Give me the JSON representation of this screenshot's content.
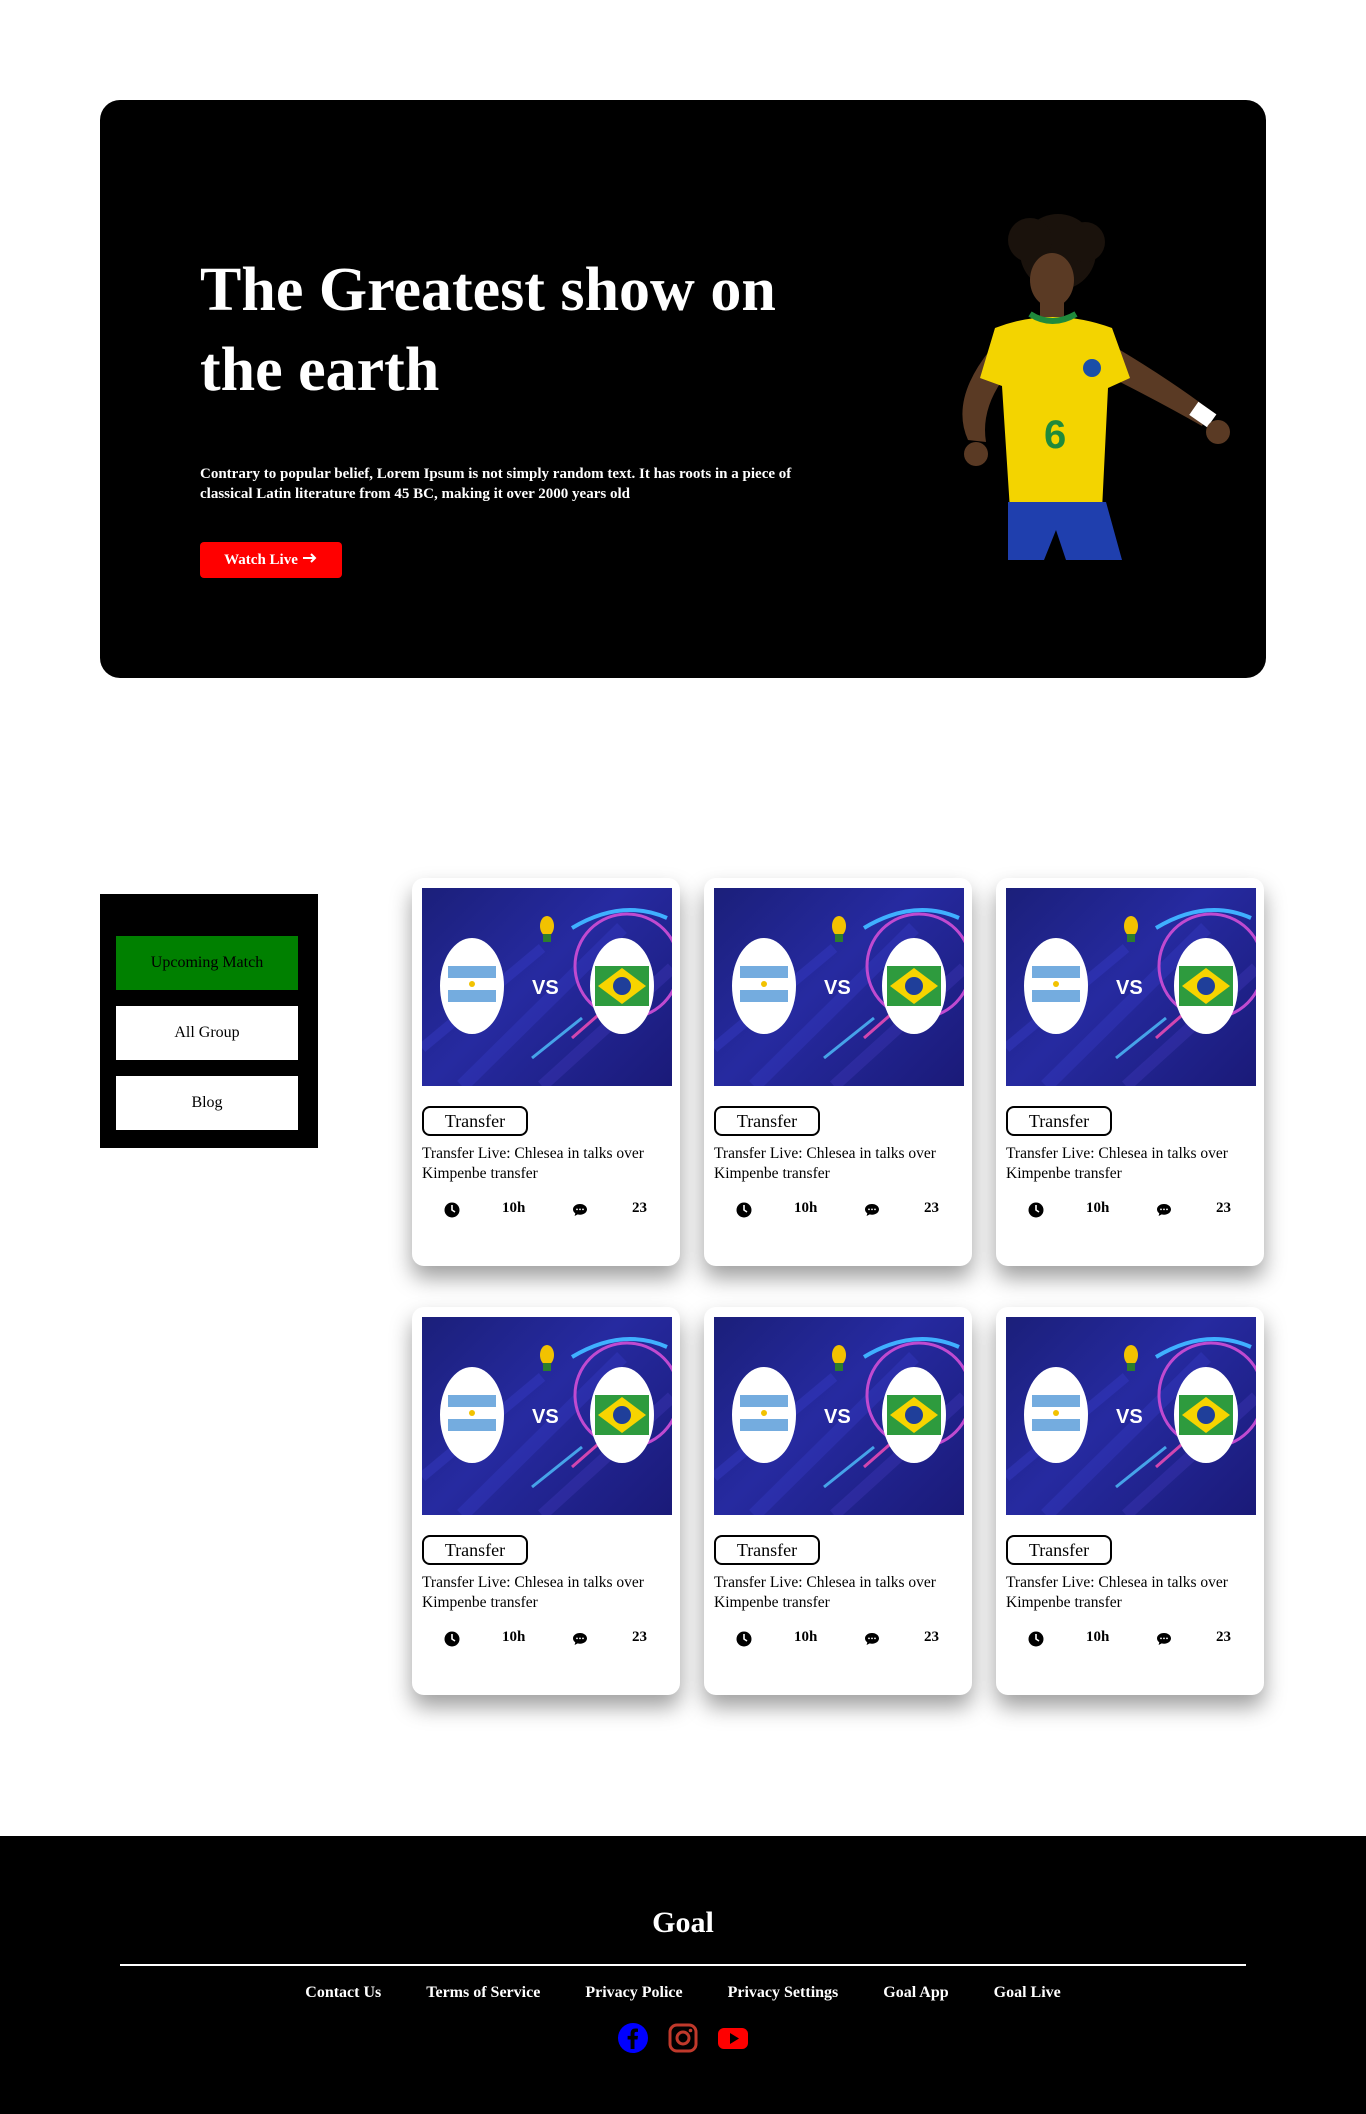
{
  "hero": {
    "title": "The Greatest show on the earth",
    "text": "Contrary to popular belief, Lorem Ipsum is not simply random text. It has roots in a piece of classical Latin literature from 45 BC, making it over 2000 years old",
    "button_label": "Watch Live",
    "button_icon": "arrow-right-icon",
    "accent_color": "#ff0000",
    "player_number": "6"
  },
  "sidebar": {
    "items": [
      {
        "label": "Upcoming Match",
        "active": true,
        "color": "#008000"
      },
      {
        "label": "All Group",
        "active": false
      },
      {
        "label": "Blog",
        "active": false
      }
    ]
  },
  "cards": [
    {
      "tag": "Transfer",
      "title": "Transfer Live: Chlesea in talks over Kimpenbe transfer",
      "versus": "VS",
      "time": "10h",
      "comments": "23"
    },
    {
      "tag": "Transfer",
      "title": "Transfer Live: Chlesea in talks over Kimpenbe transfer",
      "versus": "VS",
      "time": "10h",
      "comments": "23"
    },
    {
      "tag": "Transfer",
      "title": "Transfer Live: Chlesea in talks over Kimpenbe transfer",
      "versus": "VS",
      "time": "10h",
      "comments": "23"
    },
    {
      "tag": "Transfer",
      "title": "Transfer Live: Chlesea in talks over Kimpenbe transfer",
      "versus": "VS",
      "time": "10h",
      "comments": "23"
    },
    {
      "tag": "Transfer",
      "title": "Transfer Live: Chlesea in talks over Kimpenbe transfer",
      "versus": "VS",
      "time": "10h",
      "comments": "23"
    },
    {
      "tag": "Transfer",
      "title": "Transfer Live: Chlesea in talks over Kimpenbe transfer",
      "versus": "VS",
      "time": "10h",
      "comments": "23"
    }
  ],
  "footer": {
    "brand": "Goal",
    "links": [
      "Contact Us",
      "Terms of Service",
      "Privacy Police",
      "Privacy Settings",
      "Goal App",
      "Goal Live"
    ],
    "socials": [
      {
        "icon": "facebook-icon",
        "color": "#0000ff"
      },
      {
        "icon": "instagram-icon",
        "color": "#c0392b"
      },
      {
        "icon": "youtube-icon",
        "color": "#ff0000"
      }
    ]
  }
}
